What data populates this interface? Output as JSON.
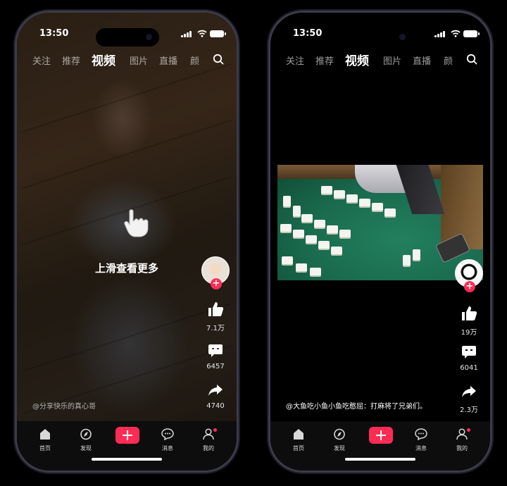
{
  "status": {
    "time": "13:50"
  },
  "nav": {
    "tabs": [
      "关注",
      "推荐",
      "视频",
      "图片",
      "直播",
      "颜"
    ],
    "active": "视频"
  },
  "bottom_nav": [
    {
      "label": "首页",
      "icon": "home-icon"
    },
    {
      "label": "发现",
      "icon": "compass-icon"
    },
    {
      "label": "",
      "icon": "plus-icon"
    },
    {
      "label": "消息",
      "icon": "message-icon"
    },
    {
      "label": "我的",
      "icon": "profile-icon"
    }
  ],
  "left": {
    "hint": "上滑查看更多",
    "likes": "7.1万",
    "comments": "6457",
    "shares": "4740",
    "author": "@分享快乐的真心哥"
  },
  "right": {
    "likes": "19万",
    "comments": "6041",
    "shares": "2.3万",
    "caption": "@大鱼吃小鱼小鱼吃憨屈：打麻将了兄弟们。"
  },
  "colors": {
    "accent": "#fe2c55",
    "background": "#000000"
  }
}
